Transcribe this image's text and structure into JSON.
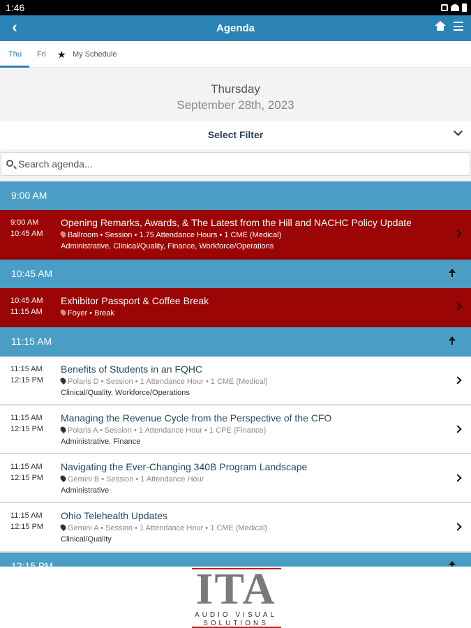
{
  "status_bar": {
    "time": "1:46"
  },
  "app_bar": {
    "title": "Agenda"
  },
  "tabs": [
    {
      "label": "Thu",
      "active": true
    },
    {
      "label": "Fri",
      "active": false
    },
    {
      "label": "My Schedule",
      "active": false
    }
  ],
  "date": {
    "day": "Thursday",
    "full": "September 28th, 2023"
  },
  "filter": {
    "label": "Select Filter"
  },
  "search": {
    "placeholder": "Search agenda..."
  },
  "time_groups": [
    "9:00 AM",
    "10:45 AM",
    "11:15 AM",
    "12:15 PM"
  ],
  "sessions": [
    {
      "start": "9:00 AM",
      "end": "10:45 AM",
      "title": "Opening Remarks, Awards, & The Latest from the Hill and NACHC Policy Update",
      "meta": "Ballroom • Session • 1.75 Attendance Hours • 1 CME (Medical)",
      "tags": "Administrative, Clinical/Quality, Finance, Workforce/Operations",
      "style": "red"
    },
    {
      "start": "10:45 AM",
      "end": "11:15 AM",
      "title": "Exhibitor Passport & Coffee Break",
      "meta": "Foyer • Break",
      "tags": "",
      "style": "red"
    },
    {
      "start": "11:15 AM",
      "end": "12:15 PM",
      "title": "Benefits of Students in an FQHC",
      "meta": "Polaris D • Session • 1 Attendance Hour • 1 CME (Medical)",
      "tags": "Clinical/Quality, Workforce/Operations",
      "style": "white"
    },
    {
      "start": "11:15 AM",
      "end": "12:15 PM",
      "title": "Managing the Revenue Cycle from the Perspective of the CFO",
      "meta": "Polaris A • Session • 1 Attendance Hour • 1 CPE (Finance)",
      "tags": "Administrative, Finance",
      "style": "white"
    },
    {
      "start": "11:15 AM",
      "end": "12:15 PM",
      "title": "Navigating the Ever-Changing 340B Program Landscape",
      "meta": "Gemini B • Session • 1 Attendance Hour",
      "tags": "Administrative",
      "style": "white"
    },
    {
      "start": "11:15 AM",
      "end": "12:15 PM",
      "title": "Ohio Telehealth Updates",
      "meta": "Gemini A • Session • 1 Attendance Hour • 1 CME (Medical)",
      "tags": "Clinical/Quality",
      "style": "white"
    }
  ],
  "footer": {
    "logo_text": "ITA",
    "logo_sub1": "AUDIO VISUAL",
    "logo_sub2": "SOLUTIONS"
  },
  "colors": {
    "primary": "#2b83b5",
    "time_header": "#4a9ec5",
    "highlight": "#9b0505"
  }
}
